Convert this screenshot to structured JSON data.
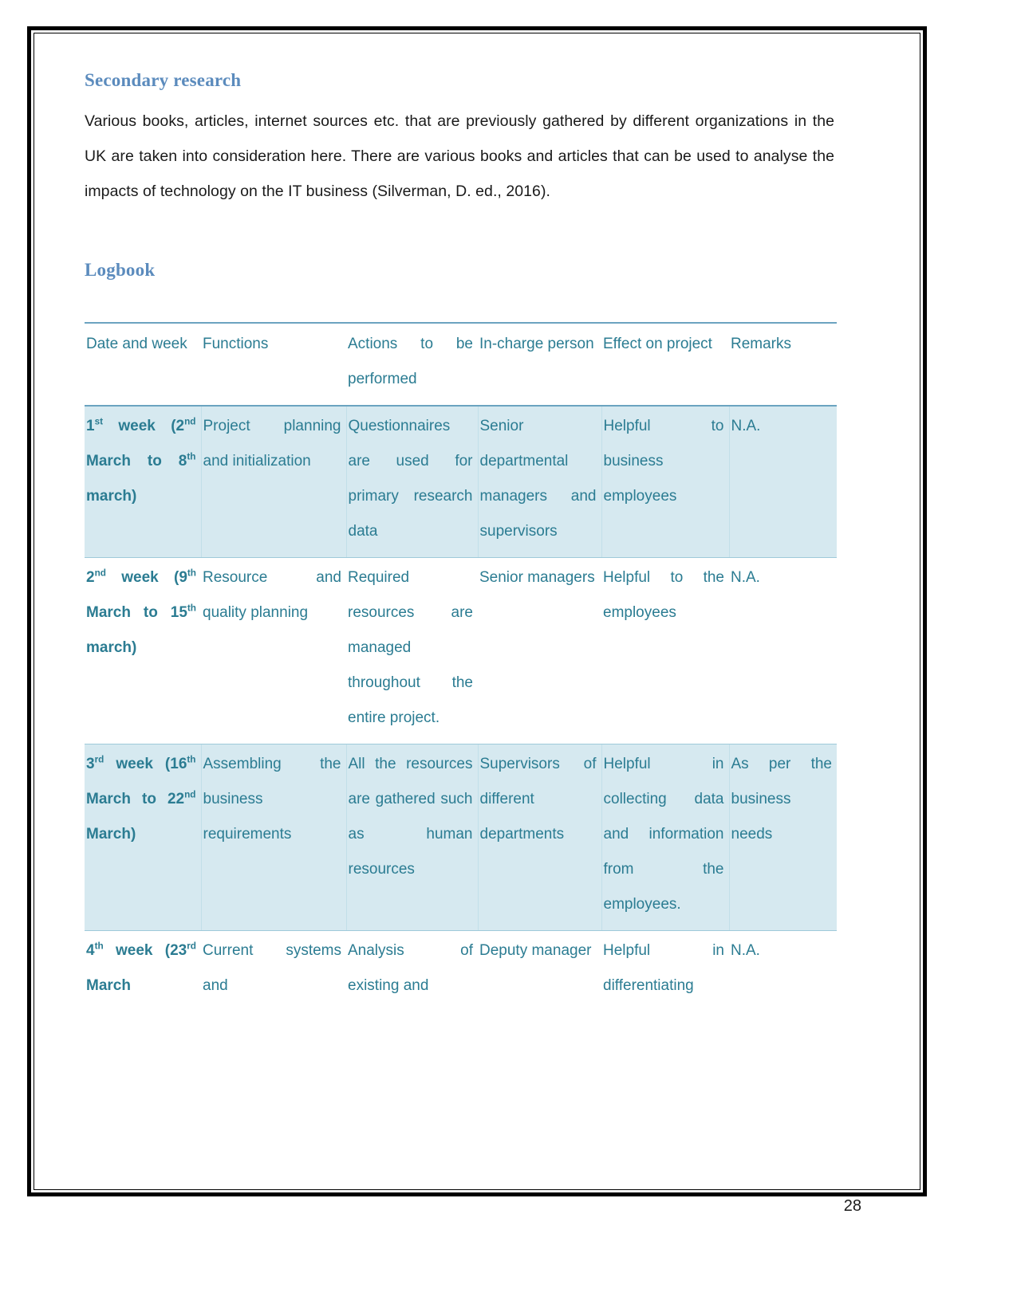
{
  "page": {
    "number": "28"
  },
  "sections": {
    "secondary_research": {
      "heading": "Secondary research",
      "paragraph": "Various books, articles, internet sources etc. that are previously gathered by different organizations in the UK are taken into consideration here. There are various books and articles that can be used to analyse the impacts of technology on the IT business (Silverman, D. ed., 2016)."
    },
    "logbook": {
      "heading": "Logbook",
      "table": {
        "headers": [
          "Date and week",
          "Functions",
          "Actions to be performed",
          "In-charge person",
          "Effect on project",
          "Remarks"
        ],
        "rows": [
          {
            "shaded": true,
            "date_parts": [
              {
                "text": "1",
                "sup": "st"
              },
              {
                "text": " week (2",
                "sup": "nd"
              },
              {
                "text": " March to 8",
                "sup": "th"
              },
              {
                "text": " march)",
                "sup": ""
              }
            ],
            "functions": "Project planning and initialization",
            "actions": "Questionnaires are used for primary research data",
            "incharge": "Senior departmental managers and supervisors",
            "effect": "Helpful to business employees",
            "remarks": "N.A."
          },
          {
            "shaded": false,
            "date_parts": [
              {
                "text": "2",
                "sup": "nd"
              },
              {
                "text": " week (9",
                "sup": "th"
              },
              {
                "text": " March to 15",
                "sup": "th"
              },
              {
                "text": " march)",
                "sup": ""
              }
            ],
            "functions": "Resource and quality planning",
            "actions": "Required resources are managed throughout the entire project.",
            "incharge": "Senior managers",
            "effect": "Helpful to the employees",
            "remarks": "N.A."
          },
          {
            "shaded": true,
            "date_parts": [
              {
                "text": "3",
                "sup": "rd"
              },
              {
                "text": " week (16",
                "sup": "th"
              },
              {
                "text": " March to 22",
                "sup": "nd"
              },
              {
                "text": " March)",
                "sup": ""
              }
            ],
            "functions": "Assembling the business requirements",
            "actions": "All the resources are gathered such as human resources",
            "incharge": "Supervisors of different departments",
            "effect": "Helpful in collecting data and information from the employees.",
            "remarks": "As per the business needs"
          },
          {
            "shaded": false,
            "date_parts": [
              {
                "text": "4",
                "sup": "th"
              },
              {
                "text": " week (23",
                "sup": "rd"
              },
              {
                "text": " March",
                "sup": ""
              }
            ],
            "functions": "Current systems and",
            "actions": "Analysis of existing and",
            "incharge": "Deputy manager",
            "effect": "Helpful in differentiating",
            "remarks": "N.A."
          }
        ]
      }
    }
  }
}
